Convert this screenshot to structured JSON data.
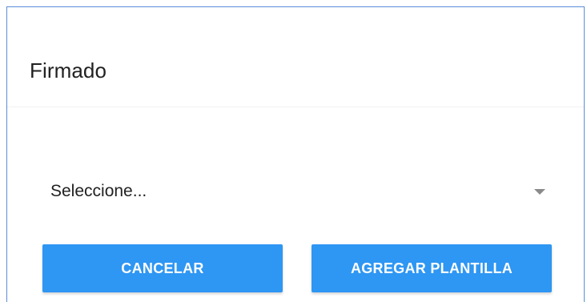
{
  "dialog": {
    "title": "Firmado",
    "select": {
      "value": "Seleccione...",
      "icon": "triangle-down-icon"
    },
    "buttons": {
      "cancel_label": "CANCELAR",
      "add_template_label": "AGREGAR PLANTILLA"
    }
  },
  "colors": {
    "accent": "#2e96f3",
    "dialog_border": "#5b8fd6",
    "title_text": "#212121",
    "arrow": "#8a8a8a"
  }
}
